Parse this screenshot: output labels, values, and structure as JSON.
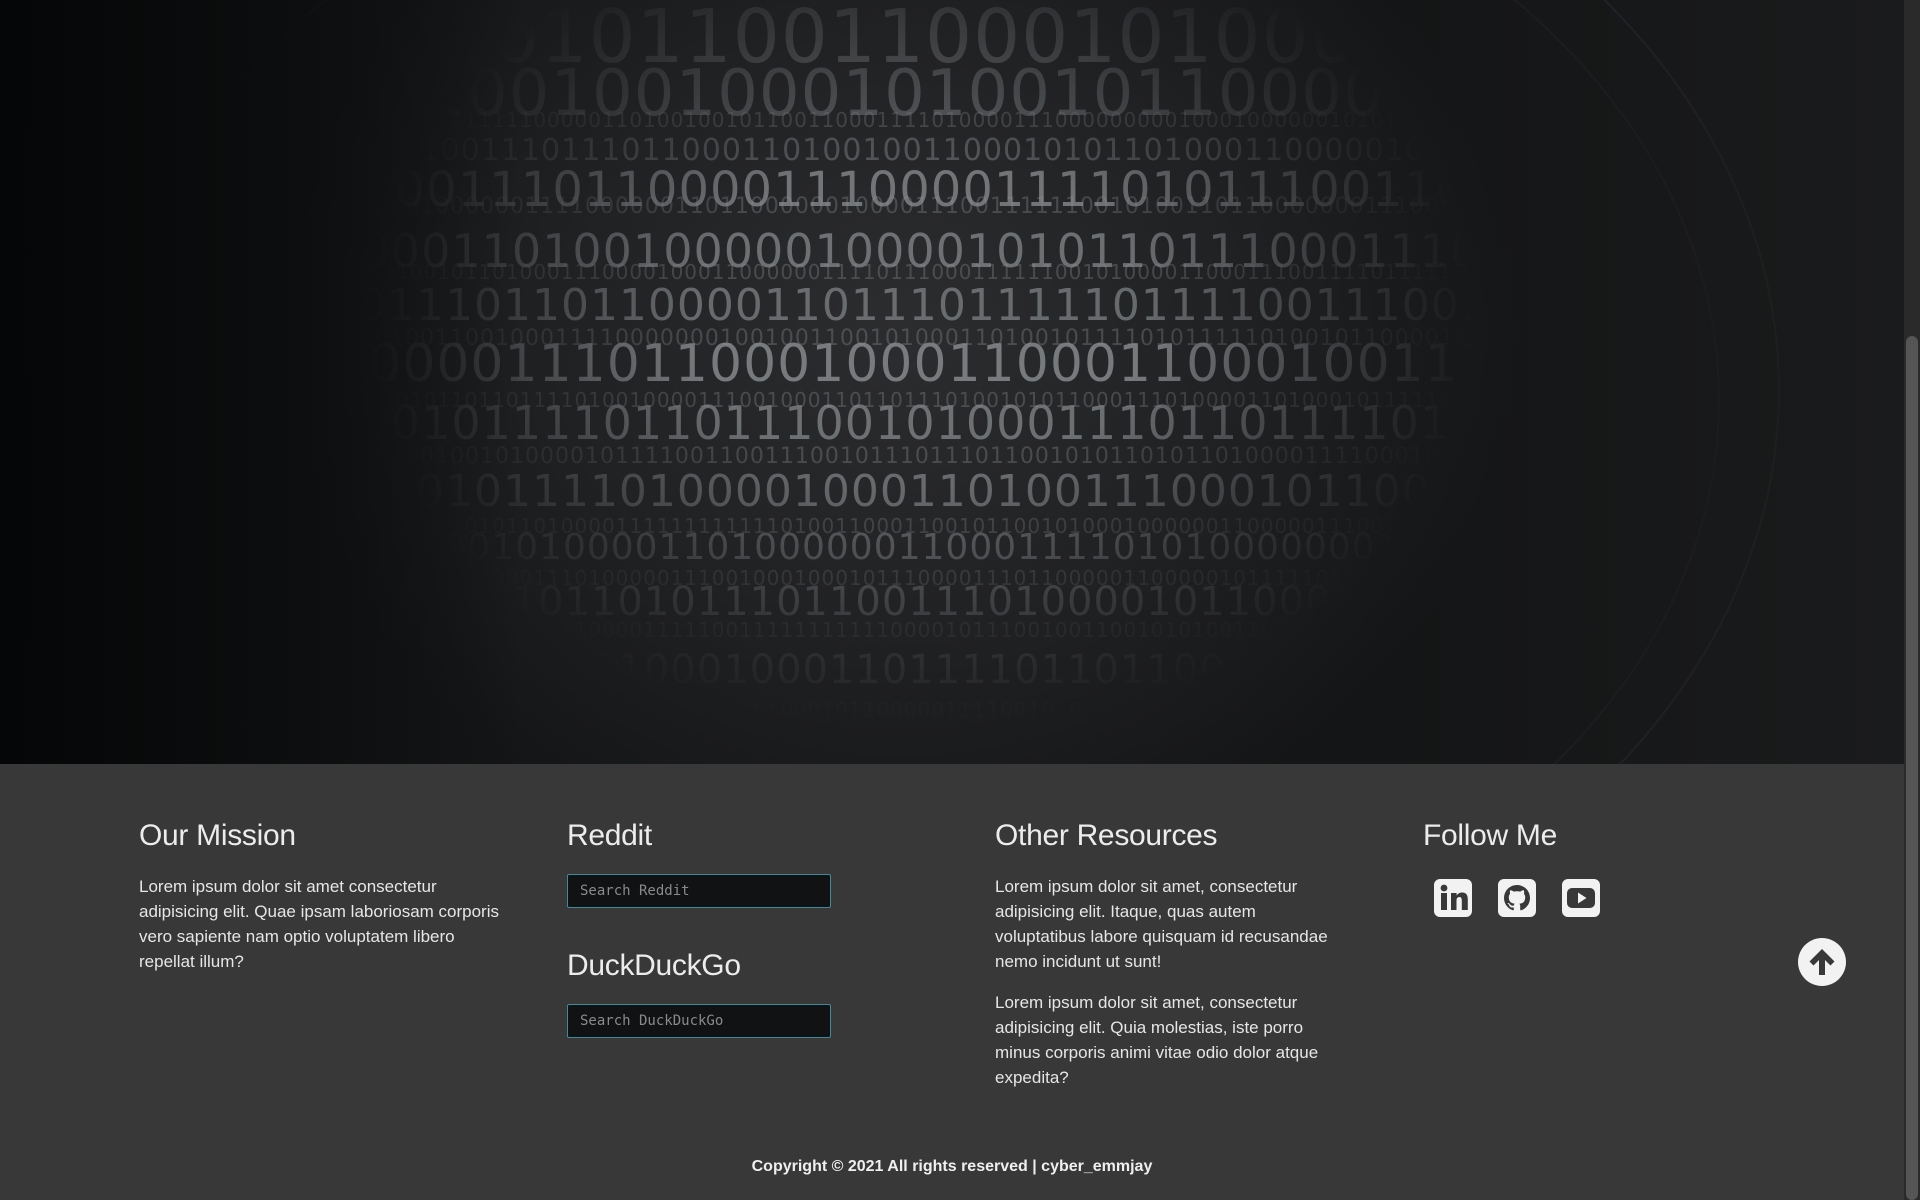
{
  "footer": {
    "mission": {
      "heading": "Our Mission",
      "text": "Lorem ipsum dolor sit amet consectetur adipisicing elit. Quae ipsam laboriosam corporis vero sapiente nam optio voluptatem libero repellat illum?"
    },
    "reddit": {
      "heading": "Reddit",
      "placeholder": "Search Reddit"
    },
    "duckduckgo": {
      "heading": "DuckDuckGo",
      "placeholder": "Search DuckDuckGo"
    },
    "resources": {
      "heading": "Other Resources",
      "paragraphs": [
        "Lorem ipsum dolor sit amet, consectetur adipisicing elit. Itaque, quas autem voluptatibus labore quisquam id recusandae nemo incidunt ut sunt!",
        "Lorem ipsum dolor sit amet, consectetur adipisicing elit. Quia molestias, iste porro minus corporis animi vitae odio dolor atque expedita?"
      ]
    },
    "follow": {
      "heading": "Follow Me",
      "icons": [
        "linkedin-icon",
        "github-icon",
        "youtube-icon"
      ]
    },
    "copyright": "Copyright © 2021 All rights reserved | cyber_emmjay"
  },
  "hero": {
    "image": "binary-code-face"
  },
  "colors": {
    "footer_bg": "#383838",
    "input_border": "#3f8a9a",
    "input_bg": "#111213",
    "icon_fill": "#f2f2f2"
  }
}
